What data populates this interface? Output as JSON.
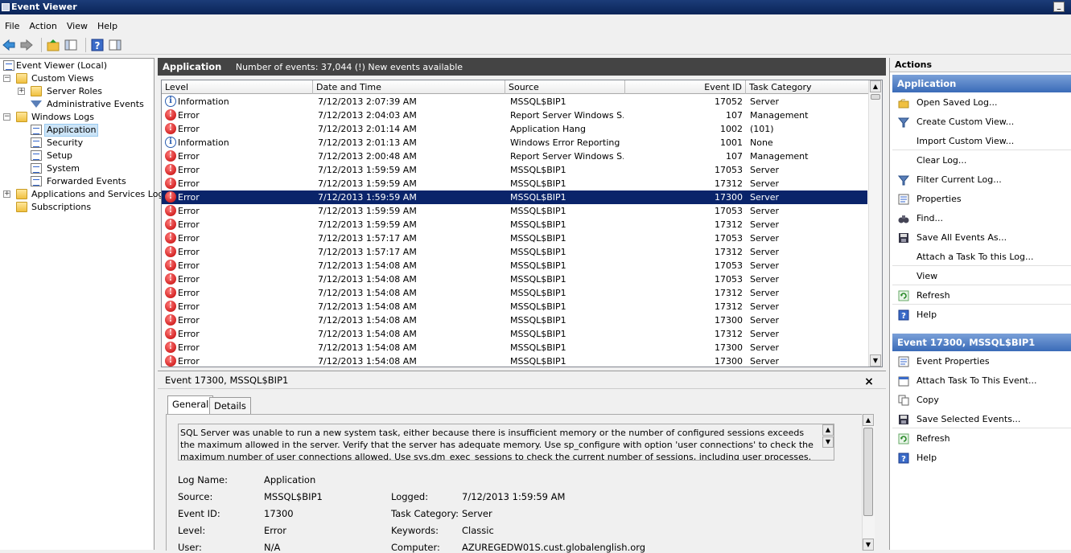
{
  "window": {
    "title": "Event Viewer"
  },
  "menu": [
    "File",
    "Action",
    "View",
    "Help"
  ],
  "tree": {
    "items": [
      {
        "label": "Event Viewer (Local)",
        "icon": "event-viewer-icon"
      },
      {
        "label": "Custom Views",
        "icon": "folder-icon"
      },
      {
        "label": "Server Roles",
        "icon": "folder-icon"
      },
      {
        "label": "Administrative Events",
        "icon": "filter-icon"
      },
      {
        "label": "Windows Logs",
        "icon": "folder-icon"
      },
      {
        "label": "Application",
        "icon": "log-icon"
      },
      {
        "label": "Security",
        "icon": "log-icon"
      },
      {
        "label": "Setup",
        "icon": "log-icon"
      },
      {
        "label": "System",
        "icon": "log-icon"
      },
      {
        "label": "Forwarded Events",
        "icon": "log-icon"
      },
      {
        "label": "Applications and Services Logs",
        "icon": "folder-icon"
      },
      {
        "label": "Subscriptions",
        "icon": "subscriptions-icon"
      }
    ]
  },
  "center": {
    "title": "Application",
    "summary": "Number of events: 37,044 (!) New events available"
  },
  "grid": {
    "columns": [
      "Level",
      "Date and Time",
      "Source",
      "Event ID",
      "Task Category"
    ],
    "rows": [
      {
        "level": "Information",
        "date": "7/12/2013 2:07:39 AM",
        "source": "MSSQL$BIP1",
        "id": "17052",
        "task": "Server"
      },
      {
        "level": "Error",
        "date": "7/12/2013 2:04:03 AM",
        "source": "Report Server Windows S...",
        "id": "107",
        "task": "Management"
      },
      {
        "level": "Error",
        "date": "7/12/2013 2:01:14 AM",
        "source": "Application Hang",
        "id": "1002",
        "task": "(101)"
      },
      {
        "level": "Information",
        "date": "7/12/2013 2:01:13 AM",
        "source": "Windows Error Reporting",
        "id": "1001",
        "task": "None"
      },
      {
        "level": "Error",
        "date": "7/12/2013 2:00:48 AM",
        "source": "Report Server Windows S...",
        "id": "107",
        "task": "Management"
      },
      {
        "level": "Error",
        "date": "7/12/2013 1:59:59 AM",
        "source": "MSSQL$BIP1",
        "id": "17053",
        "task": "Server"
      },
      {
        "level": "Error",
        "date": "7/12/2013 1:59:59 AM",
        "source": "MSSQL$BIP1",
        "id": "17312",
        "task": "Server"
      },
      {
        "level": "Error",
        "date": "7/12/2013 1:59:59 AM",
        "source": "MSSQL$BIP1",
        "id": "17300",
        "task": "Server"
      },
      {
        "level": "Error",
        "date": "7/12/2013 1:59:59 AM",
        "source": "MSSQL$BIP1",
        "id": "17053",
        "task": "Server"
      },
      {
        "level": "Error",
        "date": "7/12/2013 1:59:59 AM",
        "source": "MSSQL$BIP1",
        "id": "17312",
        "task": "Server"
      },
      {
        "level": "Error",
        "date": "7/12/2013 1:57:17 AM",
        "source": "MSSQL$BIP1",
        "id": "17053",
        "task": "Server"
      },
      {
        "level": "Error",
        "date": "7/12/2013 1:57:17 AM",
        "source": "MSSQL$BIP1",
        "id": "17312",
        "task": "Server"
      },
      {
        "level": "Error",
        "date": "7/12/2013 1:54:08 AM",
        "source": "MSSQL$BIP1",
        "id": "17053",
        "task": "Server"
      },
      {
        "level": "Error",
        "date": "7/12/2013 1:54:08 AM",
        "source": "MSSQL$BIP1",
        "id": "17053",
        "task": "Server"
      },
      {
        "level": "Error",
        "date": "7/12/2013 1:54:08 AM",
        "source": "MSSQL$BIP1",
        "id": "17312",
        "task": "Server"
      },
      {
        "level": "Error",
        "date": "7/12/2013 1:54:08 AM",
        "source": "MSSQL$BIP1",
        "id": "17312",
        "task": "Server"
      },
      {
        "level": "Error",
        "date": "7/12/2013 1:54:08 AM",
        "source": "MSSQL$BIP1",
        "id": "17300",
        "task": "Server"
      },
      {
        "level": "Error",
        "date": "7/12/2013 1:54:08 AM",
        "source": "MSSQL$BIP1",
        "id": "17312",
        "task": "Server"
      },
      {
        "level": "Error",
        "date": "7/12/2013 1:54:08 AM",
        "source": "MSSQL$BIP1",
        "id": "17300",
        "task": "Server"
      },
      {
        "level": "Error",
        "date": "7/12/2013 1:54:08 AM",
        "source": "MSSQL$BIP1",
        "id": "17300",
        "task": "Server"
      }
    ],
    "selected_index": 7
  },
  "detail": {
    "title": "Event 17300, MSSQL$BIP1",
    "close": "×",
    "tabs": [
      "General",
      "Details"
    ],
    "description": "SQL Server was unable to run a new system task, either because there is insufficient memory or the number of configured sessions exceeds the maximum allowed in the server. Verify that the server has adequate memory. Use sp_configure with option 'user connections' to check the maximum number of user connections allowed. Use sys.dm_exec_sessions to check the current number of sessions, including user processes.",
    "fields": {
      "log_name_label": "Log Name:",
      "log_name": "Application",
      "source_label": "Source:",
      "source": "MSSQL$BIP1",
      "logged_label": "Logged:",
      "logged": "7/12/2013 1:59:59 AM",
      "event_id_label": "Event ID:",
      "event_id": "17300",
      "task_label": "Task Category:",
      "task": "Server",
      "level_label": "Level:",
      "level": "Error",
      "keywords_label": "Keywords:",
      "keywords": "Classic",
      "user_label": "User:",
      "user": "N/A",
      "computer_label": "Computer:",
      "computer": "AZUREGEDW01S.cust.globalenglish.org"
    }
  },
  "actions": {
    "header": "Actions",
    "section1": "Application",
    "items1": [
      {
        "label": "Open Saved Log...",
        "icon": "open-folder-icon"
      },
      {
        "label": "Create Custom View...",
        "icon": "filter-icon"
      },
      {
        "label": "Import Custom View...",
        "icon": ""
      },
      {
        "label": "Clear Log...",
        "icon": ""
      },
      {
        "label": "Filter Current Log...",
        "icon": "filter-icon"
      },
      {
        "label": "Properties",
        "icon": "properties-icon"
      },
      {
        "label": "Find...",
        "icon": "binoculars-icon"
      },
      {
        "label": "Save All Events As...",
        "icon": "save-icon"
      },
      {
        "label": "Attach a Task To this Log...",
        "icon": ""
      },
      {
        "label": "View",
        "icon": ""
      },
      {
        "label": "Refresh",
        "icon": "refresh-icon"
      },
      {
        "label": "Help",
        "icon": "help-icon"
      }
    ],
    "section2": "Event 17300, MSSQL$BIP1",
    "items2": [
      {
        "label": "Event Properties",
        "icon": "properties-icon"
      },
      {
        "label": "Attach Task To This Event...",
        "icon": "task-icon"
      },
      {
        "label": "Copy",
        "icon": "copy-icon"
      },
      {
        "label": "Save Selected Events...",
        "icon": "save-icon"
      },
      {
        "label": "Refresh",
        "icon": "refresh-icon"
      },
      {
        "label": "Help",
        "icon": "help-icon"
      }
    ]
  },
  "colors": {
    "title_bar": "#0a2458",
    "selected_row": "#0a246a",
    "error_red": "#c00000",
    "section_blue": "#3a6bb8"
  }
}
